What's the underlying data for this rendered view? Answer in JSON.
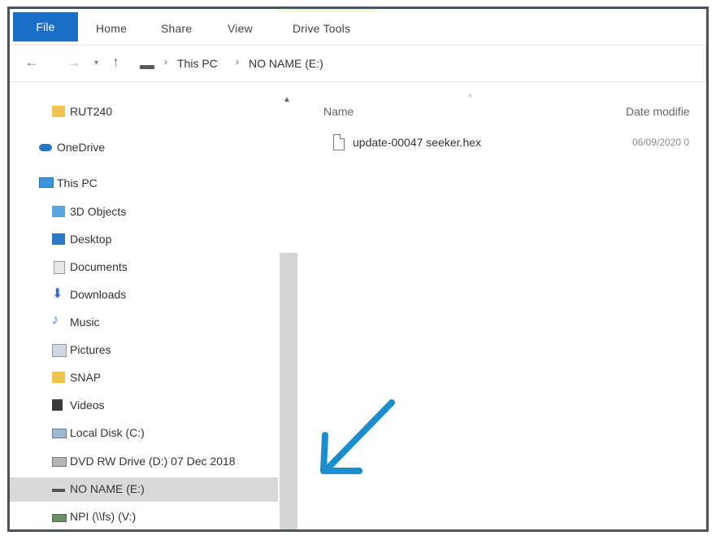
{
  "ribbon": {
    "tabs": [
      "File",
      "Home",
      "Share",
      "View",
      "Drive Tools"
    ]
  },
  "address": {
    "crumbs": [
      "This PC",
      "NO NAME (E:)"
    ]
  },
  "nav_pane": {
    "items": [
      {
        "label": "RUT240",
        "icon": "folder-icon"
      },
      {
        "label": "OneDrive",
        "icon": "cloud-icon"
      },
      {
        "label": "This PC",
        "icon": "computer-icon"
      },
      {
        "label": "3D Objects",
        "icon": "cube-icon"
      },
      {
        "label": "Desktop",
        "icon": "desktop-icon"
      },
      {
        "label": "Documents",
        "icon": "document-icon"
      },
      {
        "label": "Downloads",
        "icon": "download-icon"
      },
      {
        "label": "Music",
        "icon": "music-icon"
      },
      {
        "label": "Pictures",
        "icon": "pictures-icon"
      },
      {
        "label": "SNAP",
        "icon": "folder-icon"
      },
      {
        "label": "Videos",
        "icon": "video-icon"
      },
      {
        "label": "Local Disk (C:)",
        "icon": "disk-icon"
      },
      {
        "label": "DVD RW Drive (D:) 07 Dec 2018",
        "icon": "dvd-drive-icon"
      },
      {
        "label": "NO NAME (E:)",
        "icon": "usb-drive-icon",
        "selected": true
      },
      {
        "label": "NPI (\\\\fs) (V:)",
        "icon": "network-drive-icon"
      }
    ]
  },
  "content": {
    "columns": {
      "name": "Name",
      "date": "Date modifie"
    },
    "files": [
      {
        "name": "update-00047 seeker.hex",
        "date": "06/09/2020 0"
      }
    ]
  },
  "colors": {
    "file_tab": "#1a6fc7",
    "arrow": "#1b8ccc",
    "frame": "#4a5461",
    "selected_row": "#d9d9d9"
  }
}
